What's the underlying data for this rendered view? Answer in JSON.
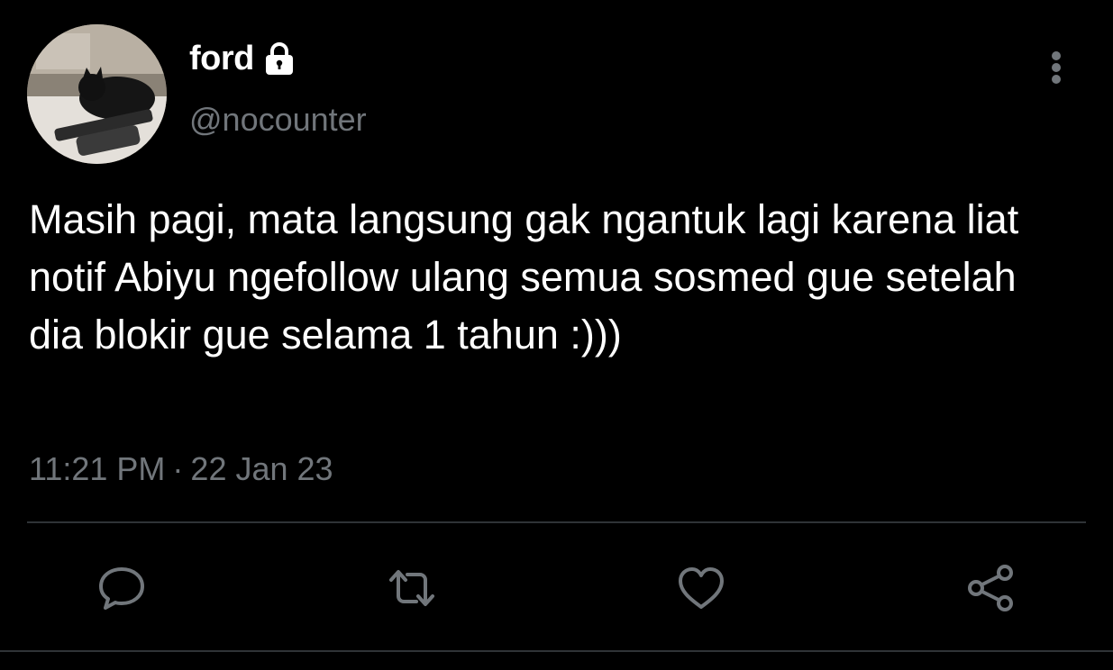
{
  "user": {
    "display_name": "ford",
    "handle": "@nocounter",
    "avatar_icon": "profile-photo-cat",
    "protected_icon": "lock-icon"
  },
  "tweet": {
    "text": "Masih pagi, mata langsung gak ngantuk lagi karena liat notif Abiyu ngefollow ulang semua sosmed gue setelah dia blokir gue selama 1 tahun :)))",
    "time": "11:21 PM",
    "separator": "·",
    "date": "22 Jan 23"
  },
  "actions": [
    {
      "name": "reply",
      "icon": "speech-bubble-icon"
    },
    {
      "name": "retweet",
      "icon": "retweet-icon"
    },
    {
      "name": "like",
      "icon": "heart-icon"
    },
    {
      "name": "share",
      "icon": "share-icon"
    }
  ],
  "colors": {
    "background": "#000000",
    "primary_text": "#ffffff",
    "secondary_text": "#71767b",
    "divider": "#2f3336"
  }
}
